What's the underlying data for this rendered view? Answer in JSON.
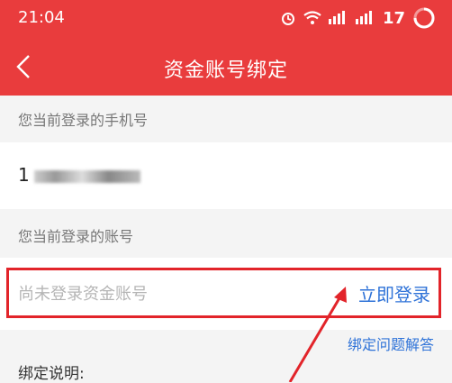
{
  "status_bar": {
    "time": "21:04",
    "battery": "17",
    "icons": [
      "alarm-icon",
      "wifi-icon",
      "signal-icon",
      "signal-icon",
      "loading-ring-icon"
    ]
  },
  "nav": {
    "title": "资金账号绑定",
    "back_icon": "back-chevron-icon"
  },
  "phone_section": {
    "label": "您当前登录的手机号",
    "value_prefix": "1"
  },
  "account_section": {
    "label": "您当前登录的账号",
    "placeholder": "尚未登录资金账号",
    "login_label": "立即登录"
  },
  "faq_label": "绑定问题解答",
  "note_label": "绑定说明:",
  "colors": {
    "header_red": "#e93c3d",
    "link_blue": "#2f73d8",
    "highlight_red": "#e2242a"
  }
}
